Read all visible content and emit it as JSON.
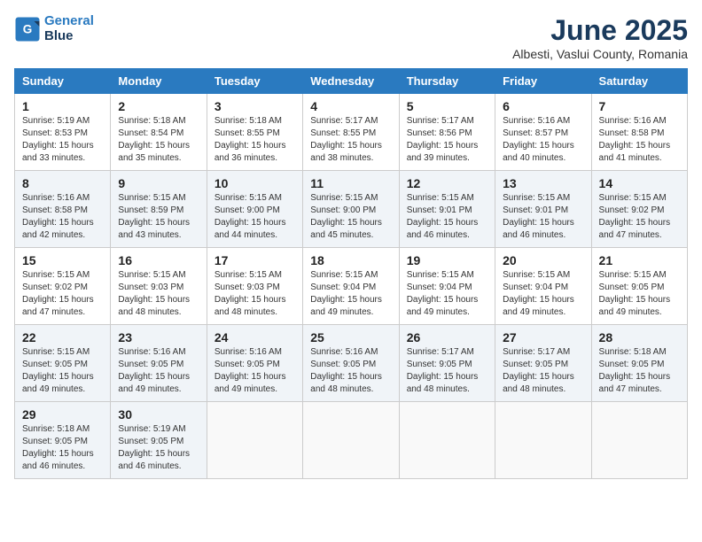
{
  "header": {
    "logo_line1": "General",
    "logo_line2": "Blue",
    "month_title": "June 2025",
    "subtitle": "Albesti, Vaslui County, Romania"
  },
  "weekdays": [
    "Sunday",
    "Monday",
    "Tuesday",
    "Wednesday",
    "Thursday",
    "Friday",
    "Saturday"
  ],
  "weeks": [
    [
      {
        "day": "1",
        "sunrise": "Sunrise: 5:19 AM",
        "sunset": "Sunset: 8:53 PM",
        "daylight": "Daylight: 15 hours and 33 minutes."
      },
      {
        "day": "2",
        "sunrise": "Sunrise: 5:18 AM",
        "sunset": "Sunset: 8:54 PM",
        "daylight": "Daylight: 15 hours and 35 minutes."
      },
      {
        "day": "3",
        "sunrise": "Sunrise: 5:18 AM",
        "sunset": "Sunset: 8:55 PM",
        "daylight": "Daylight: 15 hours and 36 minutes."
      },
      {
        "day": "4",
        "sunrise": "Sunrise: 5:17 AM",
        "sunset": "Sunset: 8:55 PM",
        "daylight": "Daylight: 15 hours and 38 minutes."
      },
      {
        "day": "5",
        "sunrise": "Sunrise: 5:17 AM",
        "sunset": "Sunset: 8:56 PM",
        "daylight": "Daylight: 15 hours and 39 minutes."
      },
      {
        "day": "6",
        "sunrise": "Sunrise: 5:16 AM",
        "sunset": "Sunset: 8:57 PM",
        "daylight": "Daylight: 15 hours and 40 minutes."
      },
      {
        "day": "7",
        "sunrise": "Sunrise: 5:16 AM",
        "sunset": "Sunset: 8:58 PM",
        "daylight": "Daylight: 15 hours and 41 minutes."
      }
    ],
    [
      {
        "day": "8",
        "sunrise": "Sunrise: 5:16 AM",
        "sunset": "Sunset: 8:58 PM",
        "daylight": "Daylight: 15 hours and 42 minutes."
      },
      {
        "day": "9",
        "sunrise": "Sunrise: 5:15 AM",
        "sunset": "Sunset: 8:59 PM",
        "daylight": "Daylight: 15 hours and 43 minutes."
      },
      {
        "day": "10",
        "sunrise": "Sunrise: 5:15 AM",
        "sunset": "Sunset: 9:00 PM",
        "daylight": "Daylight: 15 hours and 44 minutes."
      },
      {
        "day": "11",
        "sunrise": "Sunrise: 5:15 AM",
        "sunset": "Sunset: 9:00 PM",
        "daylight": "Daylight: 15 hours and 45 minutes."
      },
      {
        "day": "12",
        "sunrise": "Sunrise: 5:15 AM",
        "sunset": "Sunset: 9:01 PM",
        "daylight": "Daylight: 15 hours and 46 minutes."
      },
      {
        "day": "13",
        "sunrise": "Sunrise: 5:15 AM",
        "sunset": "Sunset: 9:01 PM",
        "daylight": "Daylight: 15 hours and 46 minutes."
      },
      {
        "day": "14",
        "sunrise": "Sunrise: 5:15 AM",
        "sunset": "Sunset: 9:02 PM",
        "daylight": "Daylight: 15 hours and 47 minutes."
      }
    ],
    [
      {
        "day": "15",
        "sunrise": "Sunrise: 5:15 AM",
        "sunset": "Sunset: 9:02 PM",
        "daylight": "Daylight: 15 hours and 47 minutes."
      },
      {
        "day": "16",
        "sunrise": "Sunrise: 5:15 AM",
        "sunset": "Sunset: 9:03 PM",
        "daylight": "Daylight: 15 hours and 48 minutes."
      },
      {
        "day": "17",
        "sunrise": "Sunrise: 5:15 AM",
        "sunset": "Sunset: 9:03 PM",
        "daylight": "Daylight: 15 hours and 48 minutes."
      },
      {
        "day": "18",
        "sunrise": "Sunrise: 5:15 AM",
        "sunset": "Sunset: 9:04 PM",
        "daylight": "Daylight: 15 hours and 49 minutes."
      },
      {
        "day": "19",
        "sunrise": "Sunrise: 5:15 AM",
        "sunset": "Sunset: 9:04 PM",
        "daylight": "Daylight: 15 hours and 49 minutes."
      },
      {
        "day": "20",
        "sunrise": "Sunrise: 5:15 AM",
        "sunset": "Sunset: 9:04 PM",
        "daylight": "Daylight: 15 hours and 49 minutes."
      },
      {
        "day": "21",
        "sunrise": "Sunrise: 5:15 AM",
        "sunset": "Sunset: 9:05 PM",
        "daylight": "Daylight: 15 hours and 49 minutes."
      }
    ],
    [
      {
        "day": "22",
        "sunrise": "Sunrise: 5:15 AM",
        "sunset": "Sunset: 9:05 PM",
        "daylight": "Daylight: 15 hours and 49 minutes."
      },
      {
        "day": "23",
        "sunrise": "Sunrise: 5:16 AM",
        "sunset": "Sunset: 9:05 PM",
        "daylight": "Daylight: 15 hours and 49 minutes."
      },
      {
        "day": "24",
        "sunrise": "Sunrise: 5:16 AM",
        "sunset": "Sunset: 9:05 PM",
        "daylight": "Daylight: 15 hours and 49 minutes."
      },
      {
        "day": "25",
        "sunrise": "Sunrise: 5:16 AM",
        "sunset": "Sunset: 9:05 PM",
        "daylight": "Daylight: 15 hours and 48 minutes."
      },
      {
        "day": "26",
        "sunrise": "Sunrise: 5:17 AM",
        "sunset": "Sunset: 9:05 PM",
        "daylight": "Daylight: 15 hours and 48 minutes."
      },
      {
        "day": "27",
        "sunrise": "Sunrise: 5:17 AM",
        "sunset": "Sunset: 9:05 PM",
        "daylight": "Daylight: 15 hours and 48 minutes."
      },
      {
        "day": "28",
        "sunrise": "Sunrise: 5:18 AM",
        "sunset": "Sunset: 9:05 PM",
        "daylight": "Daylight: 15 hours and 47 minutes."
      }
    ],
    [
      {
        "day": "29",
        "sunrise": "Sunrise: 5:18 AM",
        "sunset": "Sunset: 9:05 PM",
        "daylight": "Daylight: 15 hours and 46 minutes."
      },
      {
        "day": "30",
        "sunrise": "Sunrise: 5:19 AM",
        "sunset": "Sunset: 9:05 PM",
        "daylight": "Daylight: 15 hours and 46 minutes."
      },
      null,
      null,
      null,
      null,
      null
    ]
  ]
}
